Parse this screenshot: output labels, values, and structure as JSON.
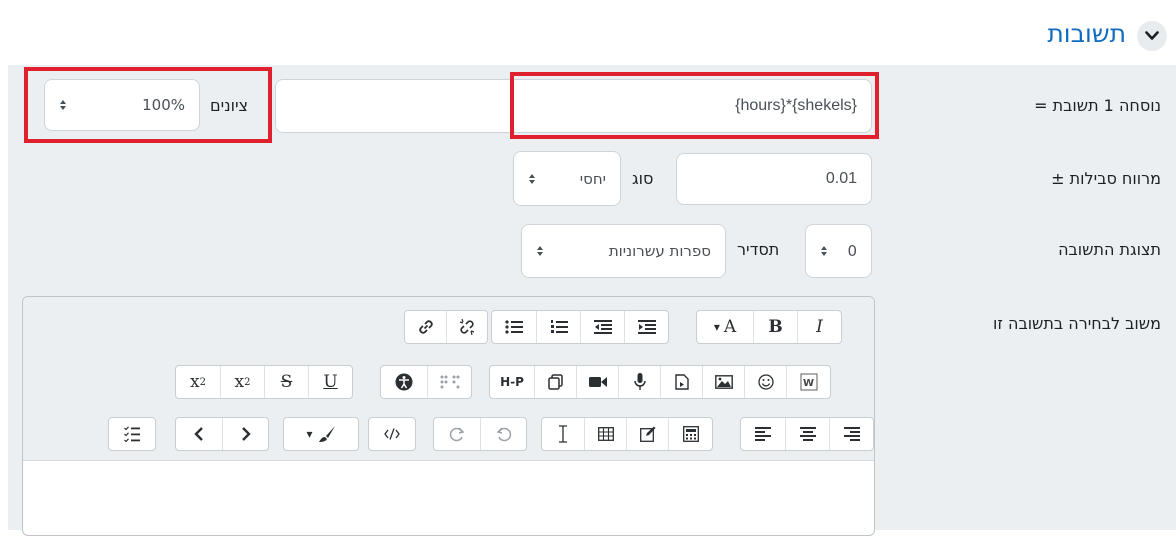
{
  "section": {
    "title": "תשובות",
    "toggle_icon": "chevron-down-icon"
  },
  "answer": {
    "label": "נוסחה 1 תשובת =",
    "formula": "{hours}*{shekels}",
    "grade_label": "ציונים",
    "grade_value": "100%"
  },
  "tolerance": {
    "label": "מרווח סבילות ±",
    "value": "0.01",
    "type_label": "סוג",
    "type_value": "יחסי"
  },
  "display": {
    "label": "תצוגת התשובה",
    "count_value": "0",
    "format_label": "תסדיר",
    "format_value": "ספרות עשרוניות"
  },
  "feedback": {
    "label": "משוב לבחירה בתשובה זו"
  },
  "toolbar": {
    "row1": [
      "format-dropdown",
      "bold",
      "italic",
      "unordered-list",
      "ordered-list",
      "outdent",
      "indent",
      "link",
      "unlink"
    ],
    "row1_text": {
      "format": "A",
      "bold": "B",
      "italic": "I"
    },
    "row2_text": {
      "underline": "U",
      "strike": "S",
      "subscript": "x",
      "sub_mark": "2",
      "superscript": "x",
      "sup_mark": "2",
      "hp": "H-P"
    }
  },
  "colors": {
    "accent": "#0f6cbf",
    "highlight": "#e0202c",
    "panel": "#eceff2"
  }
}
